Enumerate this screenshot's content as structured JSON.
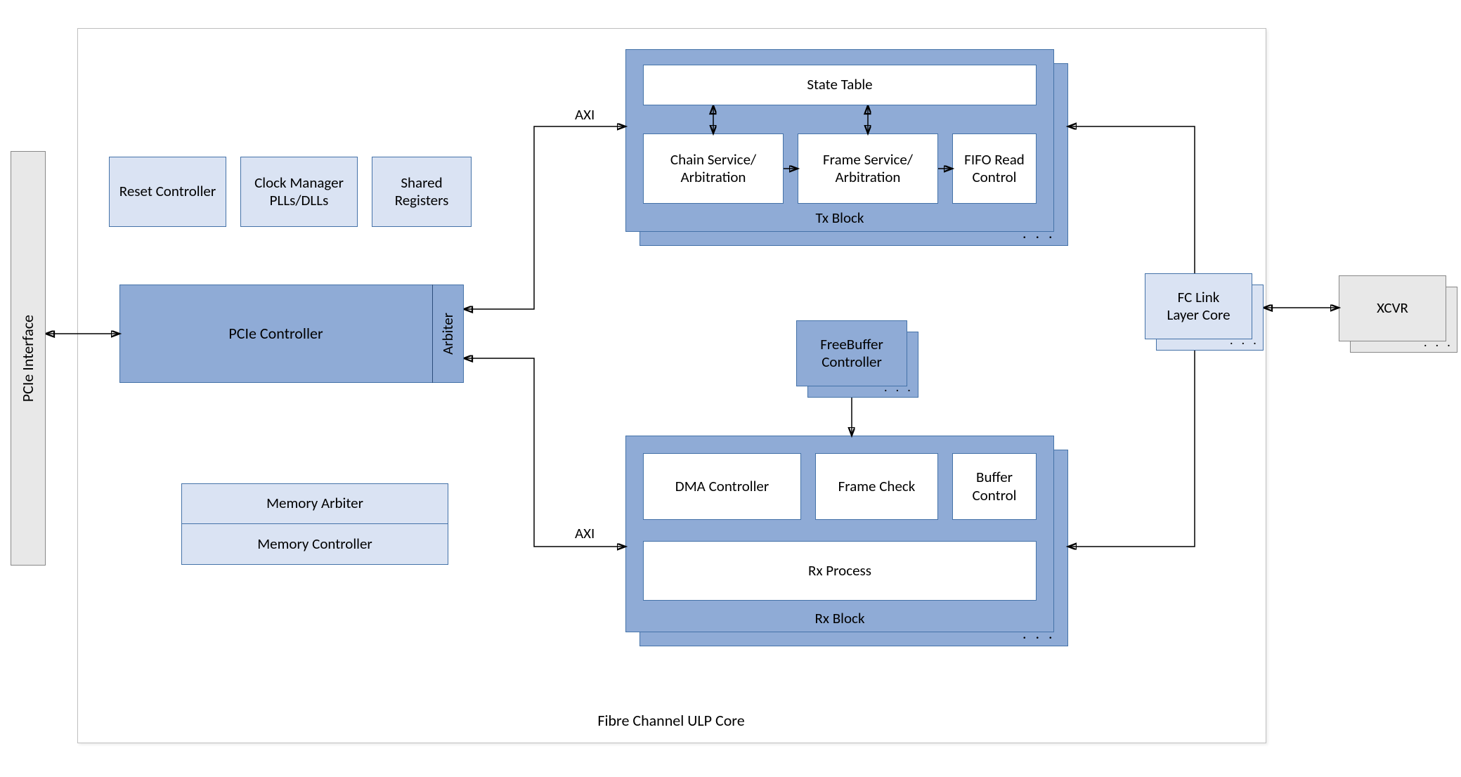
{
  "title": "Fibre Channel ULP Core",
  "pcie_interface": "PCIe Interface",
  "reset_controller": "Reset Controller",
  "clock_manager_l1": "Clock Manager",
  "clock_manager_l2": "PLLs/DLLs",
  "shared_registers_l1": "Shared",
  "shared_registers_l2": "Registers",
  "pcie_controller": "PCIe Controller",
  "arbiter": "Arbiter",
  "memory_arbiter": "Memory Arbiter",
  "memory_controller": "Memory Controller",
  "axi": "AXI",
  "tx_block": "Tx Block",
  "state_table": "State Table",
  "chain_service_l1": "Chain Service/",
  "chain_service_l2": "Arbitration",
  "frame_service_l1": "Frame Service/",
  "frame_service_l2": "Arbitration",
  "fifo_read_l1": "FIFO Read",
  "fifo_read_l2": "Control",
  "freebuffer_l1": "FreeBuffer",
  "freebuffer_l2": "Controller",
  "rx_block": "Rx Block",
  "dma_controller": "DMA Controller",
  "frame_check": "Frame Check",
  "buffer_control_l1": "Buffer",
  "buffer_control_l2": "Control",
  "rx_process": "Rx Process",
  "fc_link_l1": "FC Link",
  "fc_link_l2": "Layer Core",
  "xcvr": "XCVR",
  "ellipsis": ". . ."
}
